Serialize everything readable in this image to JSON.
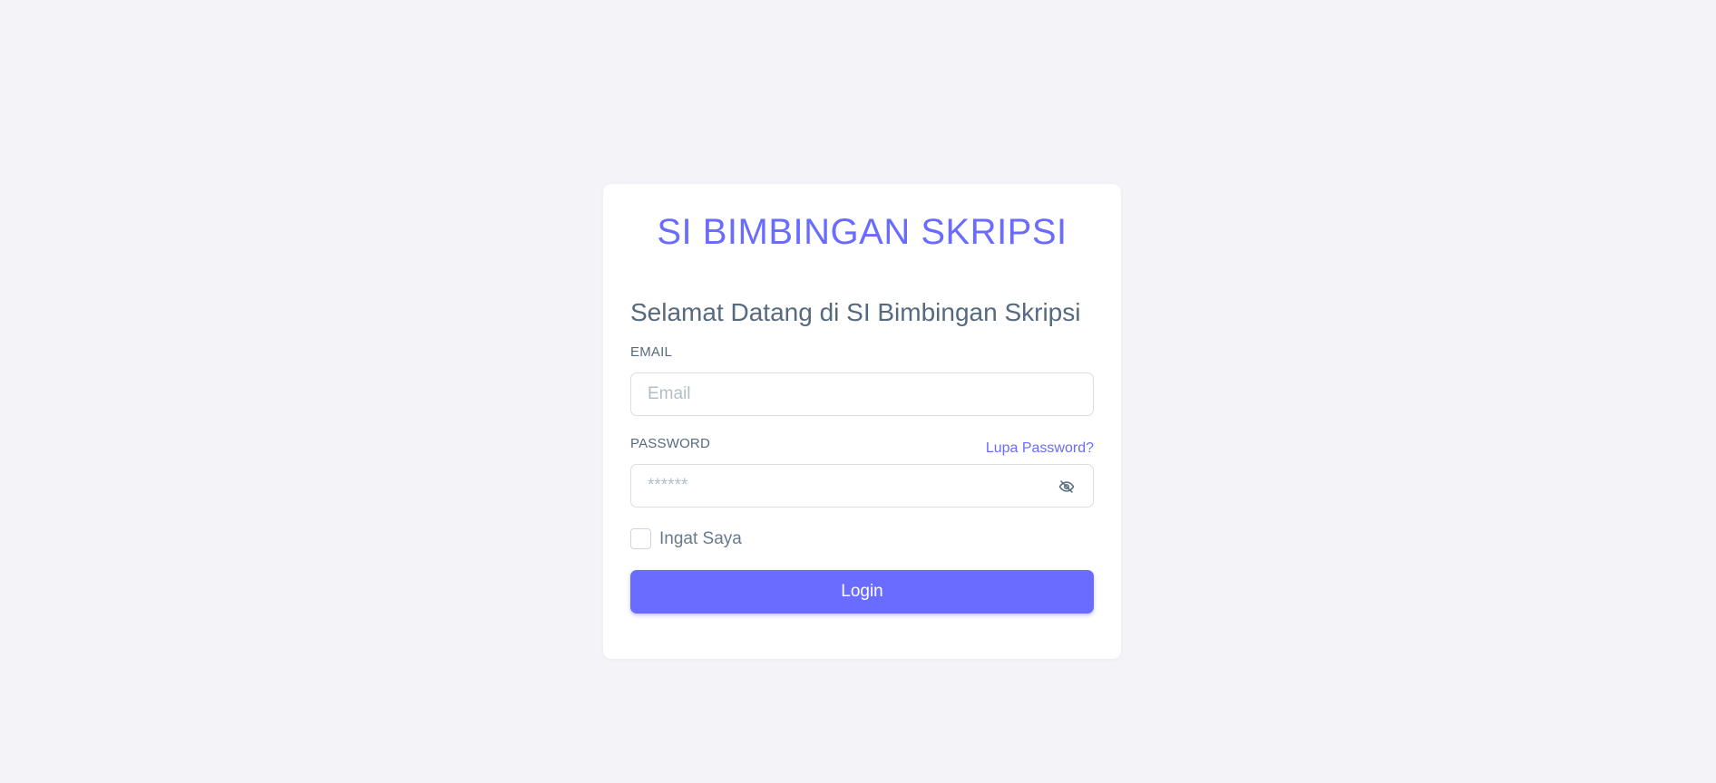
{
  "colors": {
    "accent": "#696cff",
    "text": "#566a7f",
    "muted": "#697a8d",
    "background": "#f4f4f8"
  },
  "login_card": {
    "app_title": "SI BIMBINGAN SKRIPSI",
    "welcome": "Selamat Datang di SI Bimbingan Skripsi",
    "email": {
      "label": "EMAIL",
      "placeholder": "Email",
      "value": ""
    },
    "password": {
      "label": "PASSWORD",
      "placeholder": "******",
      "value": "",
      "toggle_icon": "eye-off-icon"
    },
    "forgot_link": "Lupa Password?",
    "remember_me": {
      "label": "Ingat Saya",
      "checked": false
    },
    "login_button": "Login"
  }
}
